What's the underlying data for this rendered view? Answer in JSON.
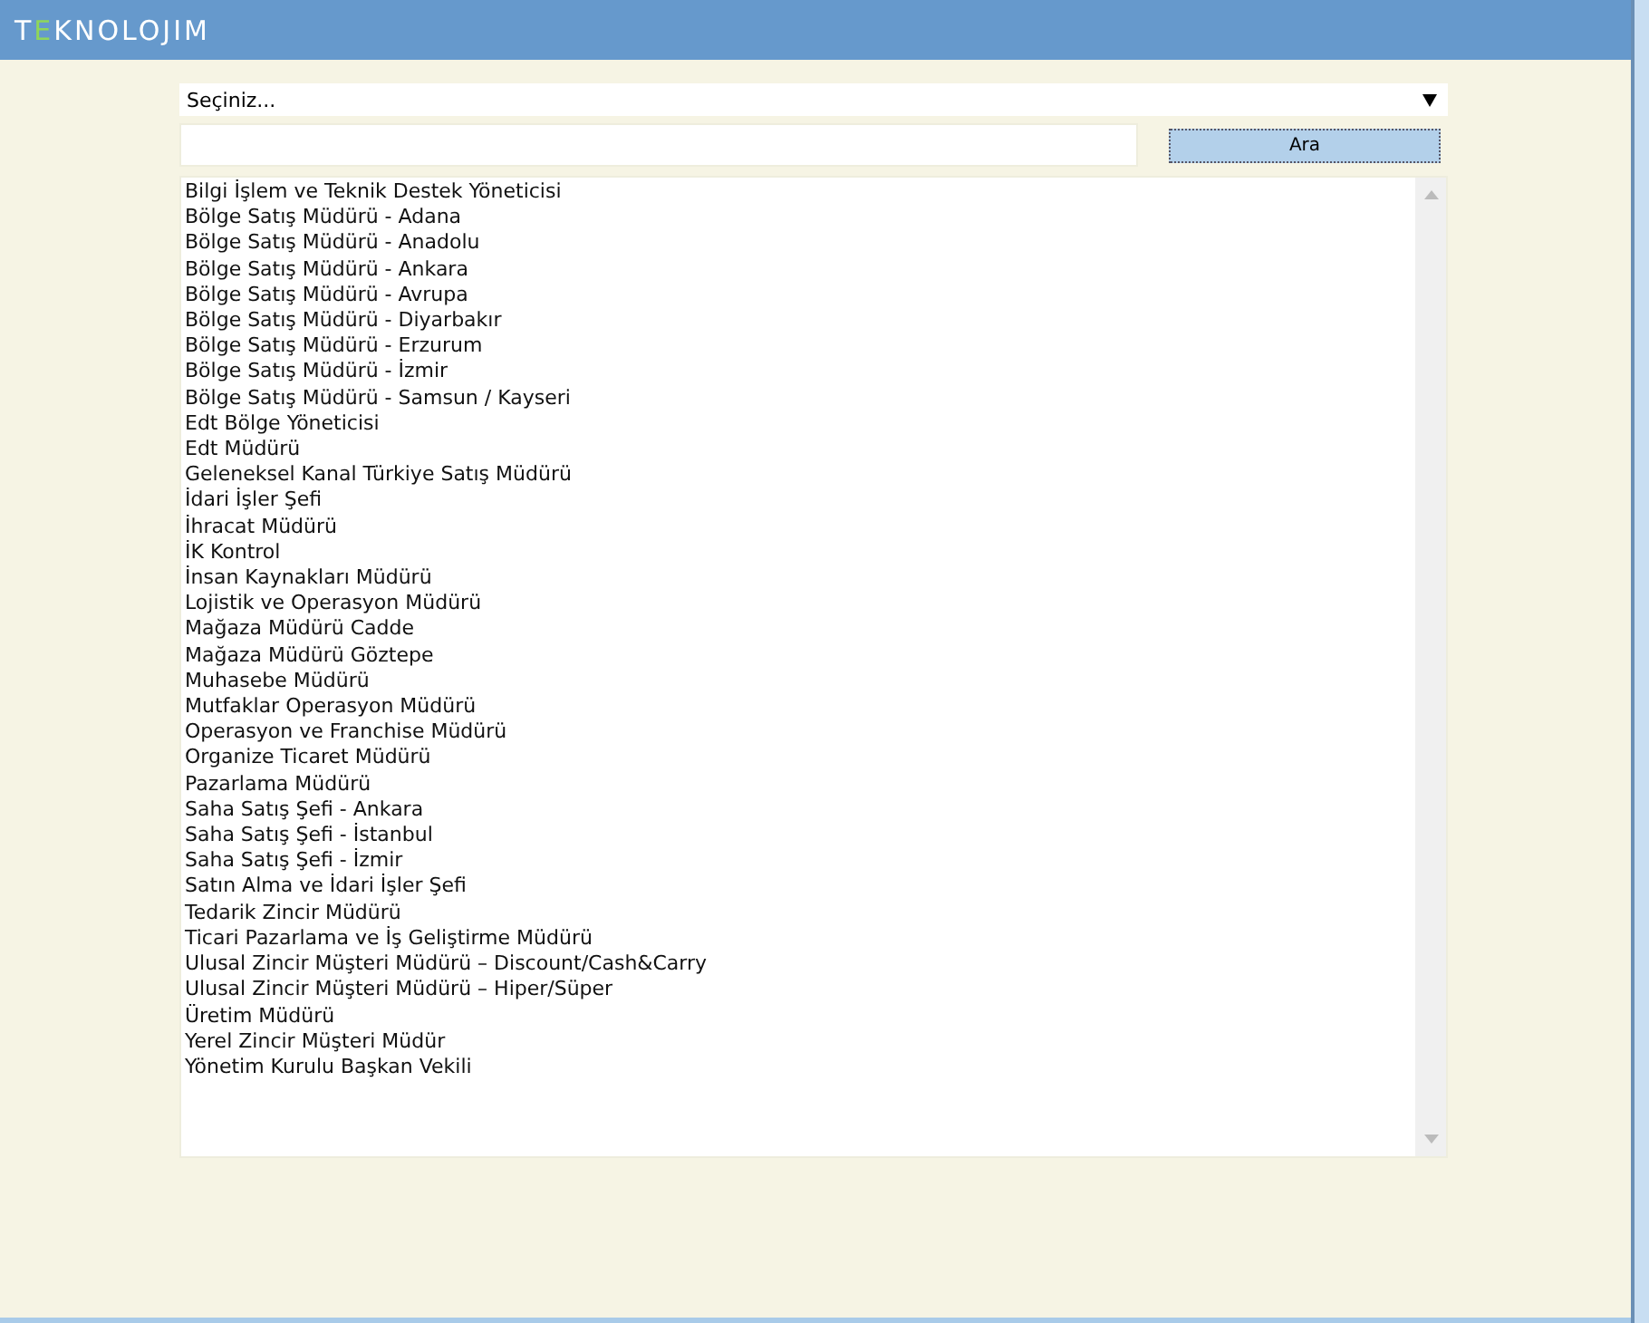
{
  "header": {
    "logo": [
      {
        "text": "T",
        "accent": false
      },
      {
        "text": "E",
        "accent": true
      },
      {
        "text": "KNOLOJIM",
        "accent": false
      }
    ]
  },
  "select": {
    "value": "Seçiniz..."
  },
  "search": {
    "button": "Ara"
  },
  "list": {
    "items": [
      "Bilgi İşlem ve Teknik Destek Yöneticisi",
      "Bölge Satış Müdürü - Adana",
      "Bölge Satış Müdürü - Anadolu",
      "Bölge Satış Müdürü - Ankara",
      "Bölge Satış Müdürü - Avrupa",
      "Bölge Satış Müdürü - Diyarbakır",
      "Bölge Satış Müdürü - Erzurum",
      "Bölge Satış Müdürü - İzmir",
      "Bölge Satış Müdürü - Samsun / Kayseri",
      "Edt Bölge Yöneticisi",
      "Edt Müdürü",
      "Geleneksel Kanal Türkiye Satış Müdürü",
      "İdari İşler Şefi",
      "İhracat Müdürü",
      "İK Kontrol",
      "İnsan Kaynakları Müdürü",
      "Lojistik ve Operasyon Müdürü",
      "Mağaza Müdürü Cadde",
      "Mağaza Müdürü Göztepe",
      "Muhasebe Müdürü",
      "Mutfaklar Operasyon Müdürü",
      "Operasyon ve Franchise Müdürü",
      "Organize Ticaret Müdürü",
      "Pazarlama Müdürü",
      "Saha Satış Şefi - Ankara",
      "Saha Satış Şefi - İstanbul",
      "Saha Satış Şefi - İzmir",
      "Satın Alma ve İdari İşler Şefi",
      "Tedarik Zincir Müdürü",
      "Ticari Pazarlama ve İş Geliştirme Müdürü",
      "Ulusal Zincir Müşteri Müdürü – Discount/Cash&Carry",
      "Ulusal Zincir Müşteri Müdürü – Hiper/Süper",
      "Üretim Müdürü",
      "Yerel Zincir Müşteri Müdür",
      "Yönetim Kurulu Başkan Vekili"
    ]
  }
}
